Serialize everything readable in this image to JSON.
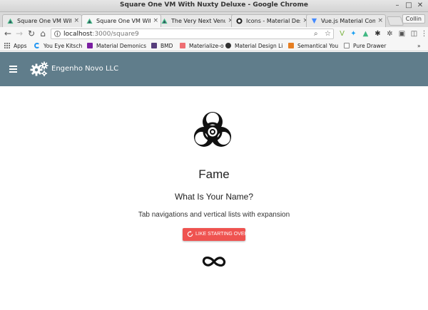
{
  "window": {
    "title": "Square One VM With Nuxty Deluxe - Google Chrome",
    "controls": {
      "minimize": "–",
      "maximize": "□",
      "close": "✕"
    }
  },
  "tabs": [
    {
      "label": "Square One VM With",
      "favicon": "vue-triangle-icon",
      "active": false
    },
    {
      "label": "Square One VM With",
      "favicon": "vue-triangle-icon",
      "active": true
    },
    {
      "label": "The Very Next Venue",
      "favicon": "vue-triangle-icon",
      "active": false
    },
    {
      "label": "Icons - Material Desi",
      "favicon": "github-icon",
      "active": false
    },
    {
      "label": "Vue.js Material Comp",
      "favicon": "vue-material-icon",
      "active": false
    }
  ],
  "tab_close": "×",
  "profile_name": "Collin",
  "toolbar": {
    "url_host": "localhost",
    "url_path": ":3000/square9",
    "info": "i"
  },
  "bookmarks": [
    {
      "label": "Apps",
      "icon": "apps-grid-icon",
      "color": "#555555"
    },
    {
      "label": "You Eye Kitsch",
      "icon": "loading-ring-icon",
      "color": "#2196f3"
    },
    {
      "label": "Material Demonics",
      "icon": "material-icon",
      "color": "#7b1fa2"
    },
    {
      "label": "BMD",
      "icon": "bootstrap-icon",
      "color": "#563d7c"
    },
    {
      "label": "Materialize-o",
      "icon": "materialize-icon",
      "color": "#ee6e73"
    },
    {
      "label": "Material Design Li",
      "icon": "circle-logo-icon",
      "color": "#333333"
    },
    {
      "label": "Semantical You",
      "icon": "semantic-icon",
      "color": "#e67e22"
    },
    {
      "label": "Pure Drawer",
      "icon": "page-icon",
      "color": "#888888"
    }
  ],
  "bookmarks_more": "»",
  "appbar": {
    "title": "Engenho Novo LLC",
    "color": "#607d8b"
  },
  "main": {
    "title": "Fame",
    "subtitle": "What Is Your Name?",
    "description": "Tab navigations and vertical lists with expansion",
    "button_label": "LIKE STARTING OVER",
    "button_color": "#ef5350"
  }
}
